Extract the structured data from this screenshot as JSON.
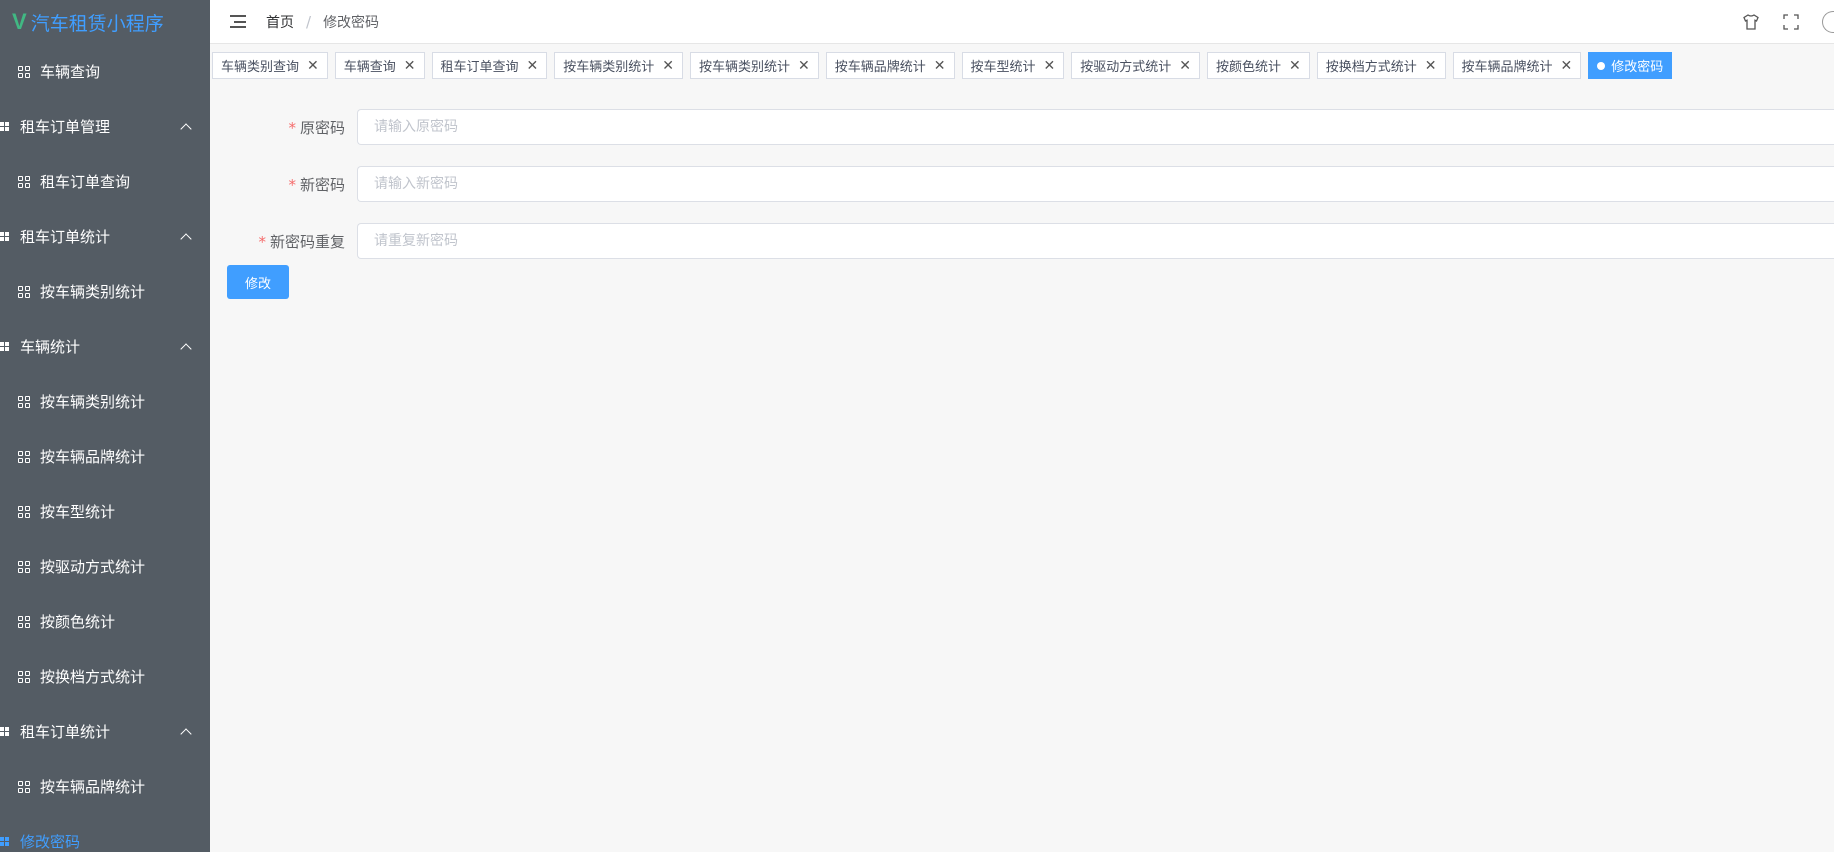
{
  "app": {
    "title": "汽车租赁小程序"
  },
  "sidebar": {
    "items": [
      {
        "label": "车辆查询",
        "type": "sub"
      },
      {
        "label": "租车订单管理",
        "type": "group"
      },
      {
        "label": "租车订单查询",
        "type": "sub"
      },
      {
        "label": "租车订单统计",
        "type": "group"
      },
      {
        "label": "按车辆类别统计",
        "type": "sub"
      },
      {
        "label": "车辆统计",
        "type": "group"
      },
      {
        "label": "按车辆类别统计",
        "type": "sub"
      },
      {
        "label": "按车辆品牌统计",
        "type": "sub"
      },
      {
        "label": "按车型统计",
        "type": "sub"
      },
      {
        "label": "按驱动方式统计",
        "type": "sub"
      },
      {
        "label": "按颜色统计",
        "type": "sub"
      },
      {
        "label": "按换档方式统计",
        "type": "sub"
      },
      {
        "label": "租车订单统计",
        "type": "group"
      },
      {
        "label": "按车辆品牌统计",
        "type": "sub"
      },
      {
        "label": "修改密码",
        "type": "group-active"
      }
    ]
  },
  "header": {
    "breadcrumb_home": "首页",
    "breadcrumb_sep": "/",
    "breadcrumb_current": "修改密码"
  },
  "tabs": [
    {
      "label": "车辆类别查询"
    },
    {
      "label": "车辆查询"
    },
    {
      "label": "租车订单查询"
    },
    {
      "label": "按车辆类别统计"
    },
    {
      "label": "按车辆类别统计"
    },
    {
      "label": "按车辆品牌统计"
    },
    {
      "label": "按车型统计"
    },
    {
      "label": "按驱动方式统计"
    },
    {
      "label": "按颜色统计"
    },
    {
      "label": "按换档方式统计"
    },
    {
      "label": "按车辆品牌统计"
    },
    {
      "label": "修改密码",
      "active": true
    }
  ],
  "form": {
    "old_password": {
      "label": "原密码",
      "placeholder": "请输入原密码",
      "value": ""
    },
    "new_password": {
      "label": "新密码",
      "placeholder": "请输入新密码",
      "value": ""
    },
    "repeat_password": {
      "label": "新密码重复",
      "placeholder": "请重复新密码",
      "value": ""
    },
    "required_mark": "*",
    "submit_label": "修改"
  },
  "colors": {
    "accent": "#409eff",
    "sidebar_bg": "#545c64",
    "required": "#f56c6c"
  }
}
